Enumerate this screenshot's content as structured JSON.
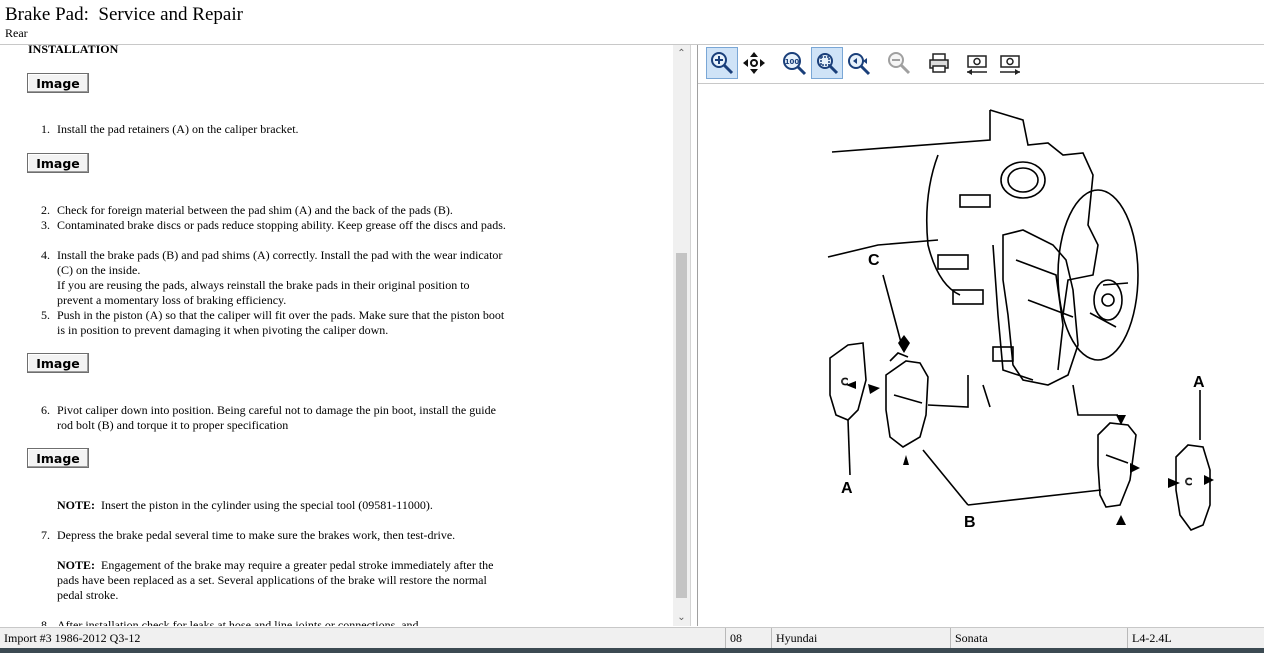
{
  "header": {
    "title": "Brake Pad:  Service and Repair",
    "subtitle": "Rear"
  },
  "content": {
    "section_title": "INSTALLATION",
    "image_button_label": "Image",
    "steps": [
      {
        "num": "1.",
        "text": "Install the pad retainers (A) on the caliper bracket."
      },
      {
        "num": "2.",
        "text": "Check for foreign material between the pad shim (A) and the back of the pads (B)."
      },
      {
        "num": "3.",
        "text": "Contaminated brake discs or pads reduce stopping ability. Keep grease off the discs and pads."
      },
      {
        "num": "4.",
        "text": "Install the brake pads (B) and pad shims (A) correctly. Install the pad with the wear indicator (C) on the inside.",
        "text2": "If you are reusing the pads, always reinstall the brake pads in their original position to prevent a momentary loss of braking efficiency."
      },
      {
        "num": "5.",
        "text": "Push in the piston (A) so that the caliper will fit over the pads. Make sure that the piston boot is in position to prevent damaging it when pivoting the caliper down."
      },
      {
        "num": "6.",
        "text": "Pivot caliper down into position. Being careful not to damage the pin boot, install the guide rod bolt (B) and torque it to proper specification"
      },
      {
        "num": "7.",
        "text": "Depress the brake pedal several time to make sure the brakes work, then test-drive."
      },
      {
        "num": "8.",
        "text": "After installation check for leaks at hose and line joints or connections, and"
      }
    ],
    "notes": [
      {
        "label": "NOTE:",
        "text": "Insert the piston in the cylinder using the special tool (09581-11000)."
      },
      {
        "label": "NOTE:",
        "text": "Engagement of the brake may require a greater pedal stroke immediately after the pads have been replaced as a set. Several applications of the brake will restore the normal pedal stroke."
      }
    ]
  },
  "toolbar": {
    "buttons": [
      {
        "icon": "zoom-in-icon",
        "active": true
      },
      {
        "icon": "pan-icon",
        "active": false
      },
      {
        "icon": "zoom-100-icon",
        "label": "100%",
        "active": false
      },
      {
        "icon": "zoom-fit-icon",
        "active": true
      },
      {
        "icon": "zoom-window-icon",
        "active": false
      },
      {
        "icon": "zoom-out-icon",
        "active": false
      },
      {
        "icon": "print-icon",
        "active": false
      },
      {
        "icon": "previous-image-icon",
        "active": false
      },
      {
        "icon": "next-image-icon",
        "active": false
      }
    ]
  },
  "diagram": {
    "labels": {
      "c": "C",
      "a_left": "A",
      "a_right": "A",
      "b": "B"
    }
  },
  "status": {
    "import": "Import #3 1986-2012 Q3-12",
    "year": "08",
    "make": "Hyundai",
    "model": "Sonata",
    "engine": "L4-2.4L"
  },
  "colors": {
    "toolbar_active": "#cfe3f7",
    "status_bg": "#f0f0f0",
    "taskbar": "#3c4a52"
  }
}
